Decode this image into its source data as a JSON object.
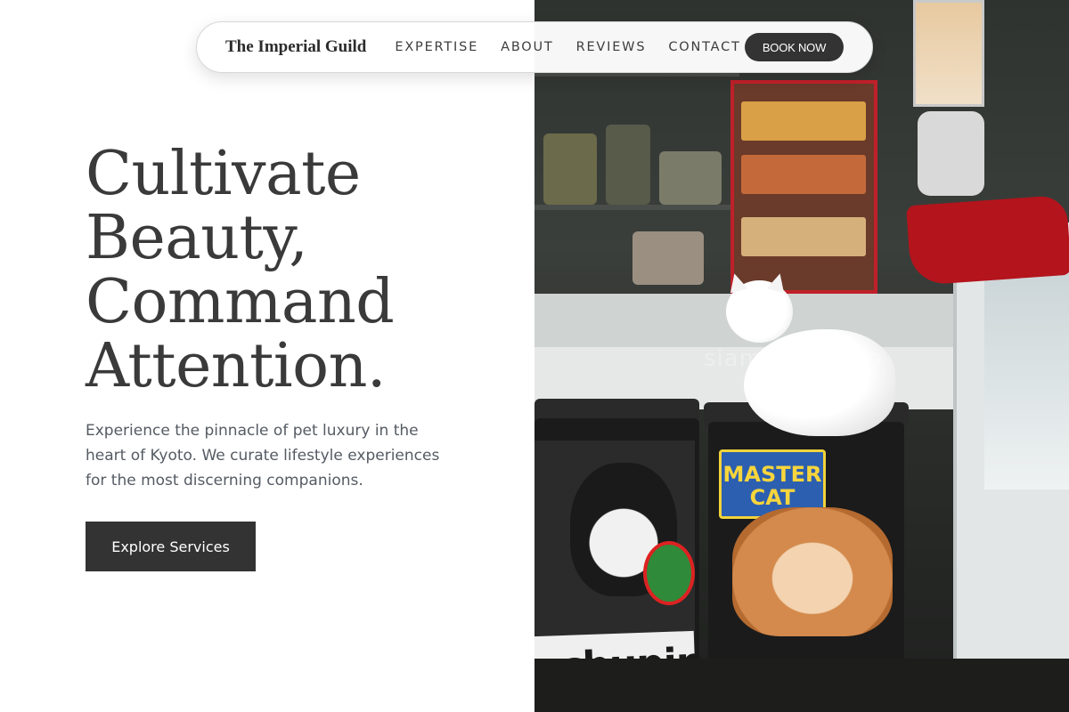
{
  "nav": {
    "brand": "The Imperial Guild",
    "links": [
      "EXPERTISE",
      "ABOUT",
      "REVIEWS",
      "CONTACT"
    ],
    "book_label": "BOOK NOW"
  },
  "hero": {
    "title_lines": [
      "Cultivate",
      "Beauty,",
      "Command",
      "Attention."
    ],
    "subtitle": "Experience the pinnacle of pet luxury in the heart of Kyoto. We curate lifestyle experiences for the most discerning companions.",
    "cta_label": "Explore Services"
  },
  "image": {
    "watermark": "siamese.tokyo",
    "bag_label": "achupin",
    "master_cat": "MASTER CAT"
  },
  "colors": {
    "primary_dark": "#333333",
    "text_heading": "#3a3a3a",
    "text_body": "#555b63",
    "background": "#ffffff"
  }
}
